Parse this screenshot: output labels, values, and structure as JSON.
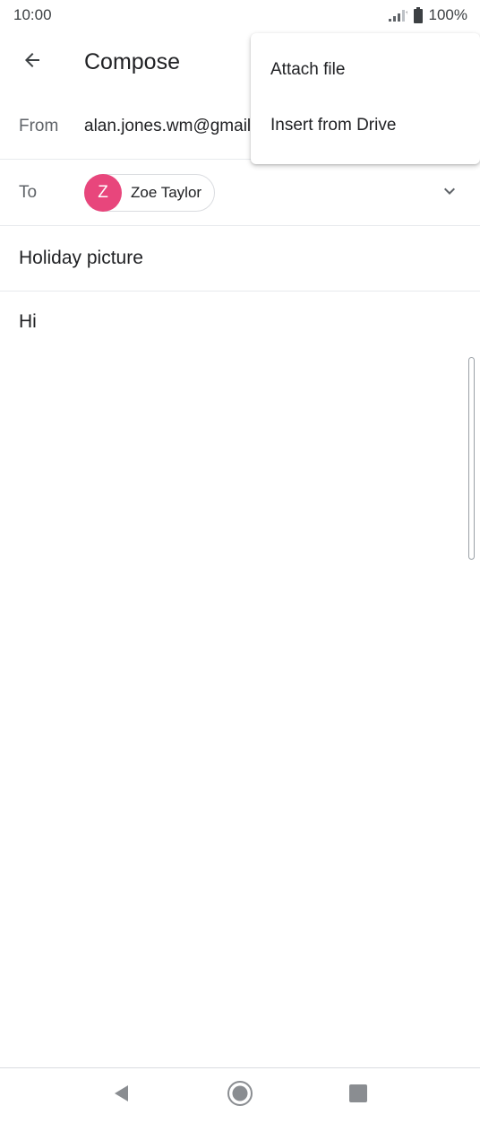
{
  "status_bar": {
    "time": "10:00",
    "battery": "100%",
    "icons": [
      "signal-icon",
      "battery-icon"
    ]
  },
  "app_bar": {
    "title": "Compose",
    "back_icon": "back-arrow-icon"
  },
  "from": {
    "label": "From",
    "value": "alan.jones.wm@gmail.com"
  },
  "to": {
    "label": "To",
    "recipient": {
      "initial": "Z",
      "name": "Zoe Taylor",
      "avatar_color": "#e8467c"
    },
    "expand_icon": "chevron-down-icon"
  },
  "subject": "Holiday picture",
  "body": "Hi",
  "overflow_menu": {
    "items": [
      {
        "label": "Attach file"
      },
      {
        "label": "Insert from Drive"
      }
    ]
  },
  "nav_bar": {
    "icons": [
      "nav-back-icon",
      "nav-home-icon",
      "nav-recents-icon"
    ]
  }
}
